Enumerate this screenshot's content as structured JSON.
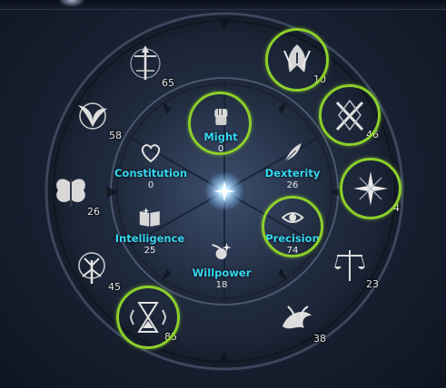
{
  "outer_nodes": [
    {
      "id": "node-spear",
      "value": "65",
      "icon": "spear-emblem-icon",
      "highlighted": false
    },
    {
      "id": "node-claw",
      "value": "10",
      "icon": "claw-emblem-icon",
      "highlighted": true
    },
    {
      "id": "node-crossed-blades",
      "value": "46",
      "icon": "crossed-blades-emblem-icon",
      "highlighted": true
    },
    {
      "id": "node-star",
      "value": "4",
      "icon": "star-emblem-icon",
      "highlighted": true
    },
    {
      "id": "node-scales",
      "value": "23",
      "icon": "scales-emblem-icon",
      "highlighted": false
    },
    {
      "id": "node-dragon",
      "value": "38",
      "icon": "dragon-emblem-icon",
      "highlighted": false
    },
    {
      "id": "node-hourglass",
      "value": "85",
      "icon": "hourglass-emblem-icon",
      "highlighted": true
    },
    {
      "id": "node-tree",
      "value": "45",
      "icon": "tree-emblem-icon",
      "highlighted": false
    },
    {
      "id": "node-butterfly",
      "value": "26",
      "icon": "butterfly-emblem-icon",
      "highlighted": false
    },
    {
      "id": "node-bird",
      "value": "58",
      "icon": "bird-emblem-icon",
      "highlighted": false
    }
  ],
  "stats": [
    {
      "id": "might",
      "label": "Might",
      "value": "0",
      "icon": "fist-icon",
      "highlighted": true
    },
    {
      "id": "dexterity",
      "label": "Dexterity",
      "value": "26",
      "icon": "feather-icon",
      "highlighted": false
    },
    {
      "id": "precision",
      "label": "Precision",
      "value": "74",
      "icon": "eye-icon",
      "highlighted": true
    },
    {
      "id": "willpower",
      "label": "Willpower",
      "value": "18",
      "icon": "comet-icon",
      "highlighted": false
    },
    {
      "id": "intelligence",
      "label": "Intelligence",
      "value": "25",
      "icon": "book-icon",
      "highlighted": false
    },
    {
      "id": "constitution",
      "label": "Constitution",
      "value": "0",
      "icon": "heart-icon",
      "highlighted": false
    }
  ],
  "colors": {
    "highlight_ring": "#8ccf2b",
    "stat_label": "#35d7f2",
    "emblem": "#d8d8d8"
  }
}
